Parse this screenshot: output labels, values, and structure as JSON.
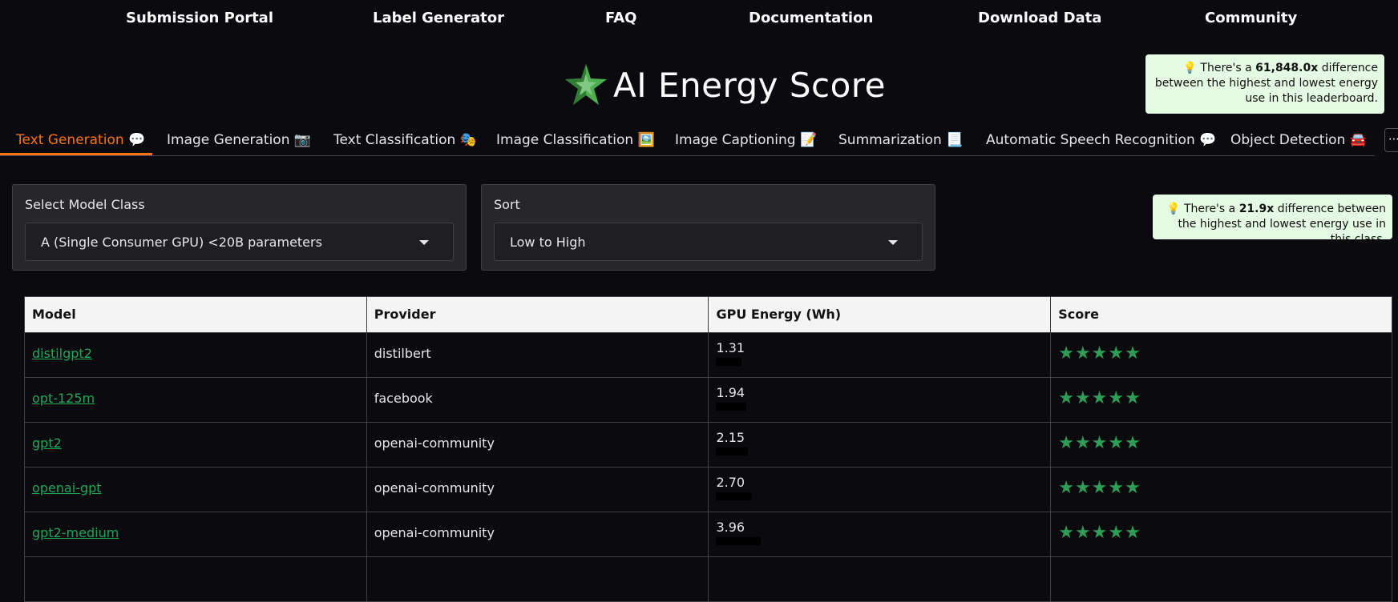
{
  "nav": [
    {
      "label": "Submission Portal"
    },
    {
      "label": "Label Generator"
    },
    {
      "label": "FAQ"
    },
    {
      "label": "Documentation"
    },
    {
      "label": "Download Data"
    },
    {
      "label": "Community"
    }
  ],
  "header": {
    "title": "AI Energy Score",
    "logo_icon": "star-leaf-icon"
  },
  "callouts": {
    "overall": {
      "prefix": "💡 There's a ",
      "value": "61,848.0x",
      "suffix": " difference between the highest and lowest energy use in this leaderboard."
    },
    "class": {
      "prefix": "💡 There's a ",
      "value": "21.9x",
      "suffix": " difference between the highest and lowest energy use in this class."
    }
  },
  "tabs": [
    {
      "label": "Text Generation 💬"
    },
    {
      "label": "Image Generation 📷"
    },
    {
      "label": "Text Classification 🎭"
    },
    {
      "label": "Image Classification 🖼️"
    },
    {
      "label": "Image Captioning 📝"
    },
    {
      "label": "Summarization 📃"
    },
    {
      "label": "Automatic Speech Recognition 💬"
    },
    {
      "label": "Object Detection 🚘"
    }
  ],
  "filters": {
    "model_class": {
      "label": "Select Model Class",
      "value": "A (Single Consumer GPU) <20B parameters"
    },
    "sort": {
      "label": "Sort",
      "value": "Low to High"
    }
  },
  "table": {
    "headers": [
      "Model",
      "Provider",
      "GPU Energy (Wh)",
      "Score"
    ],
    "rows": [
      {
        "model": "distilgpt2",
        "provider": "distilbert",
        "energy": "1.31",
        "energy_value": 1.31,
        "score": "★★★★★"
      },
      {
        "model": "opt-125m",
        "provider": "facebook",
        "energy": "1.94",
        "energy_value": 1.94,
        "score": "★★★★★"
      },
      {
        "model": "gpt2",
        "provider": "openai-community",
        "energy": "2.15",
        "energy_value": 2.15,
        "score": "★★★★★"
      },
      {
        "model": "openai-gpt",
        "provider": "openai-community",
        "energy": "2.70",
        "energy_value": 2.7,
        "score": "★★★★★"
      },
      {
        "model": "gpt2-medium",
        "provider": "openai-community",
        "energy": "3.96",
        "energy_value": 3.96,
        "score": "★★★★★"
      },
      {
        "model": "",
        "provider": "",
        "energy": "",
        "energy_value": 0,
        "score": ""
      }
    ]
  },
  "colors": {
    "accent": "#f97316",
    "link": "#22a55a",
    "stars": "#2f9e54",
    "callout_bg": "#e6fbe3"
  }
}
